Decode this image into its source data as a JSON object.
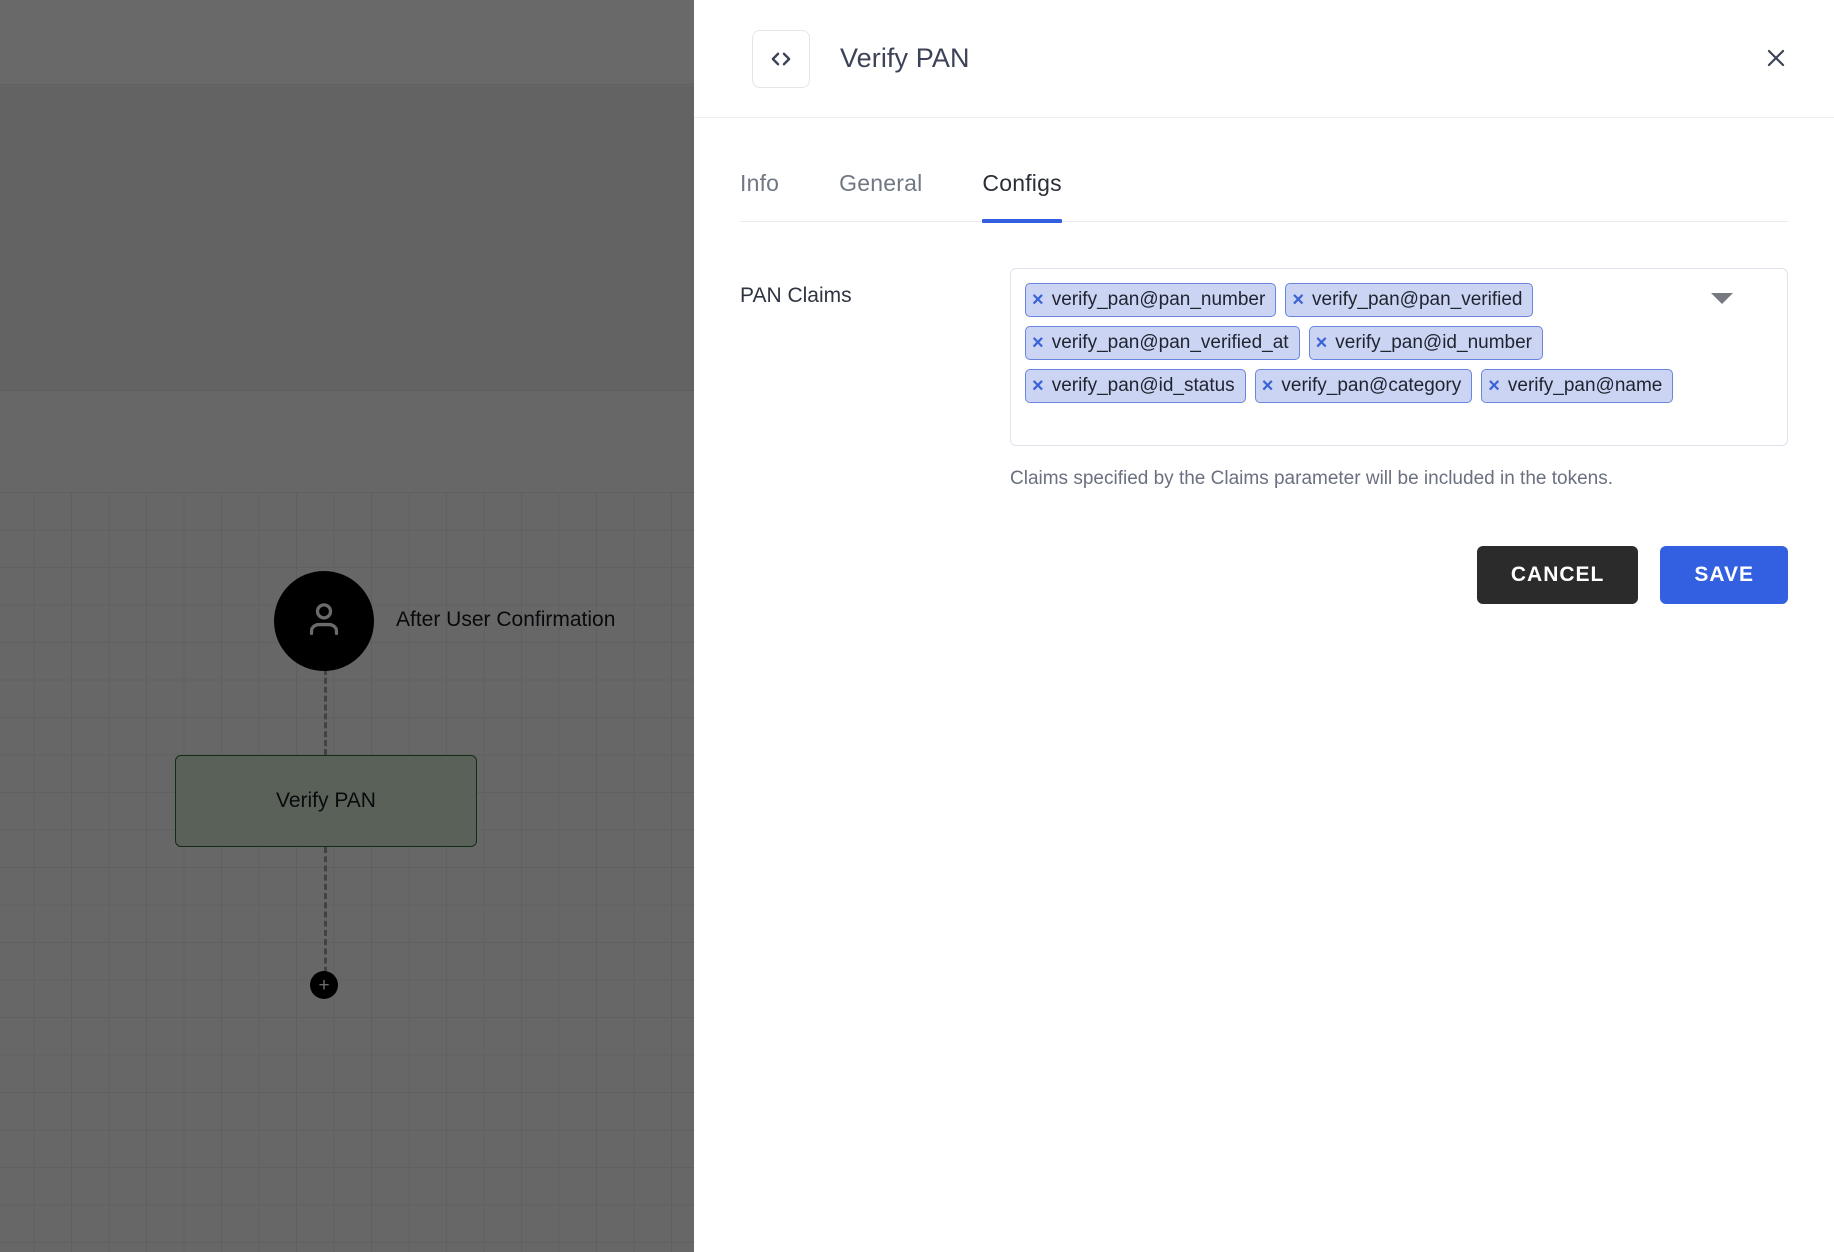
{
  "canvas": {
    "start_node_icon": "person-icon",
    "start_node_label": "After User Confirmation",
    "task_node_label": "Verify PAN",
    "add_node_label": "+"
  },
  "drawer": {
    "header": {
      "icon": "code-brackets-icon",
      "title": "Verify PAN",
      "close_icon": "close-icon"
    },
    "tabs": [
      {
        "label": "Info",
        "active": false
      },
      {
        "label": "General",
        "active": false
      },
      {
        "label": "Configs",
        "active": true
      }
    ],
    "form": {
      "field_label": "PAN Claims",
      "chips": [
        "verify_pan@pan_number",
        "verify_pan@pan_verified",
        "verify_pan@pan_verified_at",
        "verify_pan@id_number",
        "verify_pan@id_status",
        "verify_pan@category",
        "verify_pan@name"
      ],
      "chip_remove_glyph": "×",
      "dropdown_icon": "chevron-down-icon",
      "helper_text": "Claims specified by the Claims parameter will be included in the tokens."
    },
    "actions": {
      "cancel_label": "CANCEL",
      "save_label": "SAVE"
    }
  },
  "colors": {
    "accent_blue": "#3260e0",
    "cancel_dark": "#2b2b2b",
    "chip_bg": "#ccd4f3",
    "chip_border": "#6a85df",
    "chip_x": "#3a63d8",
    "node_border_green": "#2f6b33"
  }
}
